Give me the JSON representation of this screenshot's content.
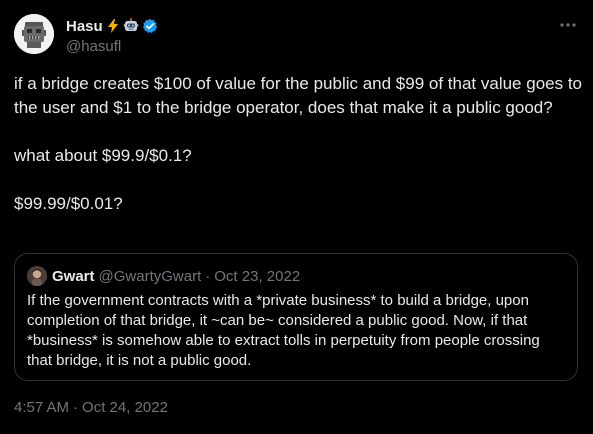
{
  "author": {
    "display_name": "Hasu",
    "handle": "@hasufl",
    "avatar_icon": "robot-avatar-icon",
    "badges": [
      "lightning-emoji-icon",
      "robot-emoji-icon",
      "verified-badge-icon"
    ],
    "verified_color": "#1d9bf0"
  },
  "more_icon": "more-dots-icon",
  "tweet": {
    "paragraphs": [
      "if a bridge creates $100 of value for the public and $99 of that value goes to the user and $1 to the bridge operator, does that make it a public good?",
      "what about $99.9/$0.1?",
      "$99.99/$0.01?"
    ]
  },
  "quote": {
    "display_name": "Gwart",
    "handle": "@GwartyGwart",
    "separator": "·",
    "date": "Oct 23, 2022",
    "text": "If the government contracts with a *private business* to build a bridge, upon completion of that bridge, it ~can be~ considered a public good. Now, if that *business* is somehow able to extract tolls in perpetuity from people crossing that bridge, it is not a public good."
  },
  "timestamp": {
    "time": "4:57 AM",
    "separator": "·",
    "date": "Oct 24, 2022"
  },
  "colors": {
    "background": "#000000",
    "text_primary": "#e7e9ea",
    "text_secondary": "#71767b",
    "border": "#2f3336"
  }
}
